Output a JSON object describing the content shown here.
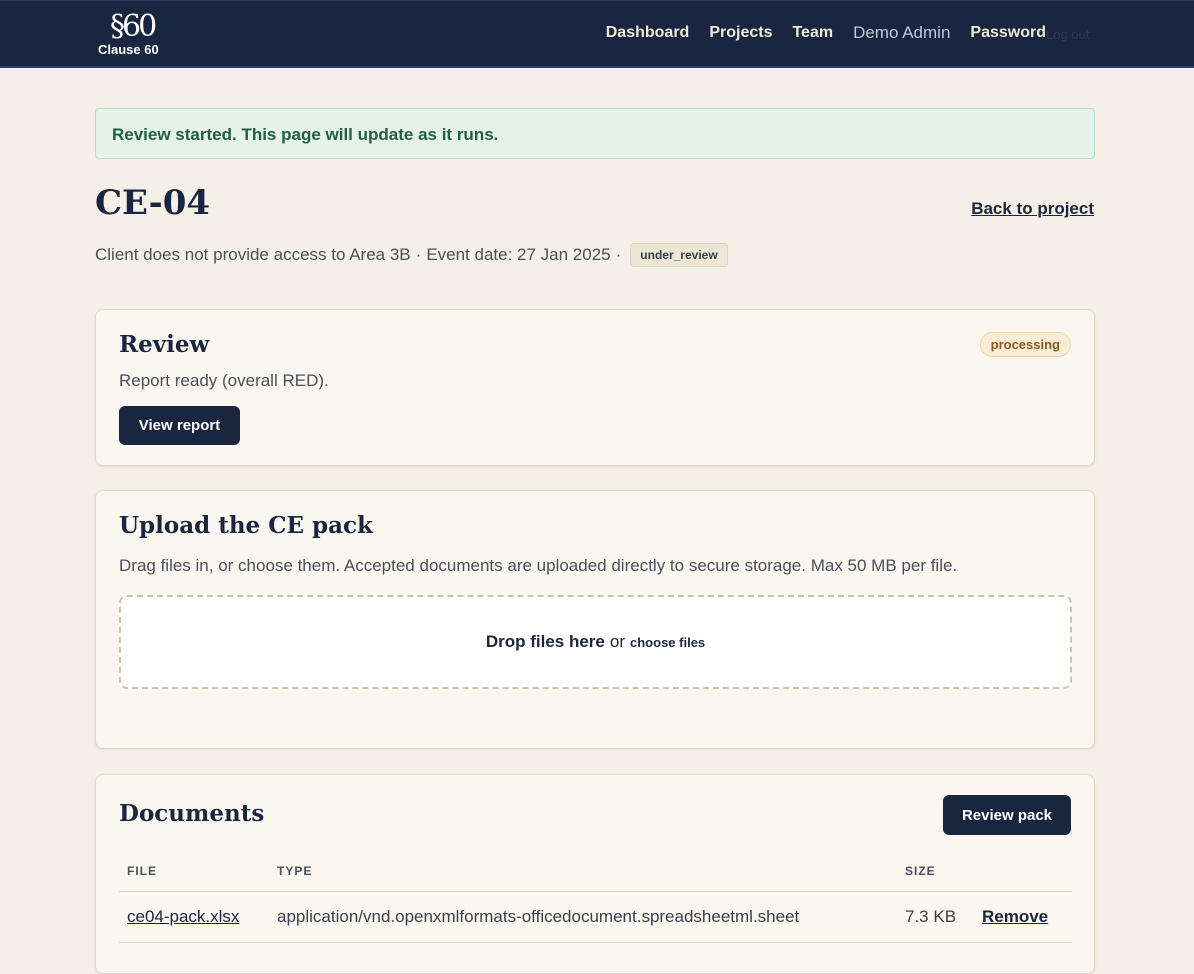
{
  "brand": {
    "mark": "§60",
    "name": "Clause 60"
  },
  "nav": {
    "items": [
      "Dashboard",
      "Projects",
      "Team"
    ],
    "user": "Demo Admin",
    "password": "Password",
    "logout": "Log out"
  },
  "flash": "Review started. This page will update as it runs.",
  "page": {
    "title": "CE-04",
    "back_link": "Back to project",
    "description": "Client does not provide access to Area 3B",
    "event_date": "Event date: 27 Jan 2025",
    "separator": "·",
    "status": "under_review"
  },
  "review": {
    "heading": "Review",
    "status": "processing",
    "message": "Report ready (overall RED).",
    "button": "View report"
  },
  "upload": {
    "heading": "Upload the CE pack",
    "description": "Drag files in, or choose them. Accepted documents are uploaded directly to secure storage. Max 50 MB per file.",
    "drop_text": "Drop files here",
    "or_text": "or",
    "choose_text": "choose files"
  },
  "documents": {
    "heading": "Documents",
    "button": "Review pack",
    "columns": [
      "FILE",
      "TYPE",
      "SIZE",
      ""
    ],
    "rows": [
      {
        "file": "ce04-pack.xlsx",
        "type": "application/vnd.openxmlformats-officedocument.spreadsheetml.sheet",
        "size": "7.3 KB",
        "action": "Remove"
      }
    ]
  }
}
